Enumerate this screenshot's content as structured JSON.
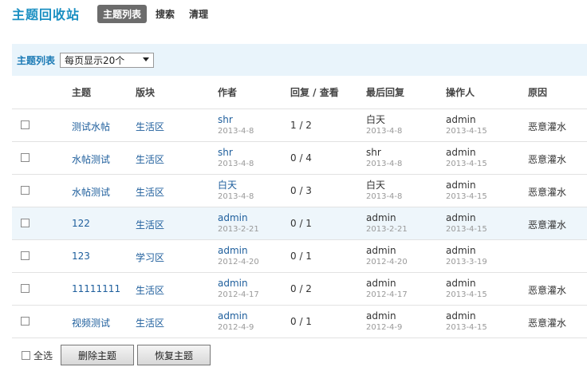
{
  "header": {
    "title": "主题回收站",
    "tabs": [
      "主题列表",
      "搜索",
      "清理"
    ]
  },
  "toolbar": {
    "label": "主题列表",
    "per_page": "每页显示20个"
  },
  "columns": {
    "topic": "主题",
    "forum": "版块",
    "author": "作者",
    "replies_views": "回复 / 查看",
    "last_reply": "最后回复",
    "operator": "操作人",
    "reason": "原因"
  },
  "rows": [
    {
      "topic": "测试水帖",
      "forum": "生活区",
      "author": "shr",
      "author_date": "2013-4-8",
      "stats": "1 / 2",
      "last": "白天",
      "last_date": "2013-4-8",
      "op": "admin",
      "op_date": "2013-4-15",
      "reason": "恶意灌水"
    },
    {
      "topic": "水帖测试",
      "forum": "生活区",
      "author": "shr",
      "author_date": "2013-4-8",
      "stats": "0 / 4",
      "last": "shr",
      "last_date": "2013-4-8",
      "op": "admin",
      "op_date": "2013-4-15",
      "reason": "恶意灌水"
    },
    {
      "topic": "水帖测试",
      "forum": "生活区",
      "author": "白天",
      "author_date": "2013-4-8",
      "stats": "0 / 3",
      "last": "白天",
      "last_date": "2013-4-8",
      "op": "admin",
      "op_date": "2013-4-15",
      "reason": "恶意灌水"
    },
    {
      "topic": "122",
      "forum": "生活区",
      "author": "admin",
      "author_date": "2013-2-21",
      "stats": "0 / 1",
      "last": "admin",
      "last_date": "2013-2-21",
      "op": "admin",
      "op_date": "2013-4-15",
      "reason": "恶意灌水"
    },
    {
      "topic": "123",
      "forum": "学习区",
      "author": "admin",
      "author_date": "2012-4-20",
      "stats": "0 / 1",
      "last": "admin",
      "last_date": "2012-4-20",
      "op": "admin",
      "op_date": "2013-3-19",
      "reason": ""
    },
    {
      "topic": "11111111",
      "forum": "生活区",
      "author": "admin",
      "author_date": "2012-4-17",
      "stats": "0 / 2",
      "last": "admin",
      "last_date": "2012-4-17",
      "op": "admin",
      "op_date": "2013-4-15",
      "reason": "恶意灌水"
    },
    {
      "topic": "视频测试",
      "forum": "生活区",
      "author": "admin",
      "author_date": "2012-4-9",
      "stats": "0 / 1",
      "last": "admin",
      "last_date": "2012-4-9",
      "op": "admin",
      "op_date": "2013-4-15",
      "reason": "恶意灌水"
    }
  ],
  "footer": {
    "select_all": "全选",
    "delete_button": "删除主题",
    "restore_button": "恢复主题"
  }
}
